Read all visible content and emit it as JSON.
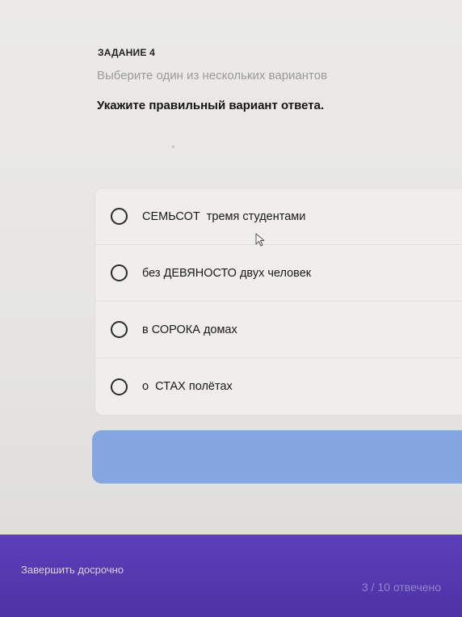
{
  "task": {
    "label": "ЗАДАНИЕ 4",
    "subtitle": "Выберите один из нескольких вариантов",
    "question": "Укажите правильный вариант ответа."
  },
  "options": [
    {
      "text": "СЕМЬСОТ  тремя студентами"
    },
    {
      "text": "без ДЕВЯНОСТО двух человек"
    },
    {
      "text": "в СОРОКА домах"
    },
    {
      "text": "о  СТАХ полётах"
    }
  ],
  "submit": {
    "label": ""
  },
  "footer": {
    "finish_early": "Завершить досрочно",
    "progress": "3 / 10 отвечено"
  },
  "icons": {
    "radio": "radio-unchecked-icon",
    "cursor": "mouse-cursor-icon"
  },
  "colors": {
    "accent": "#86a6e0",
    "footer": "#5b3fb8"
  }
}
